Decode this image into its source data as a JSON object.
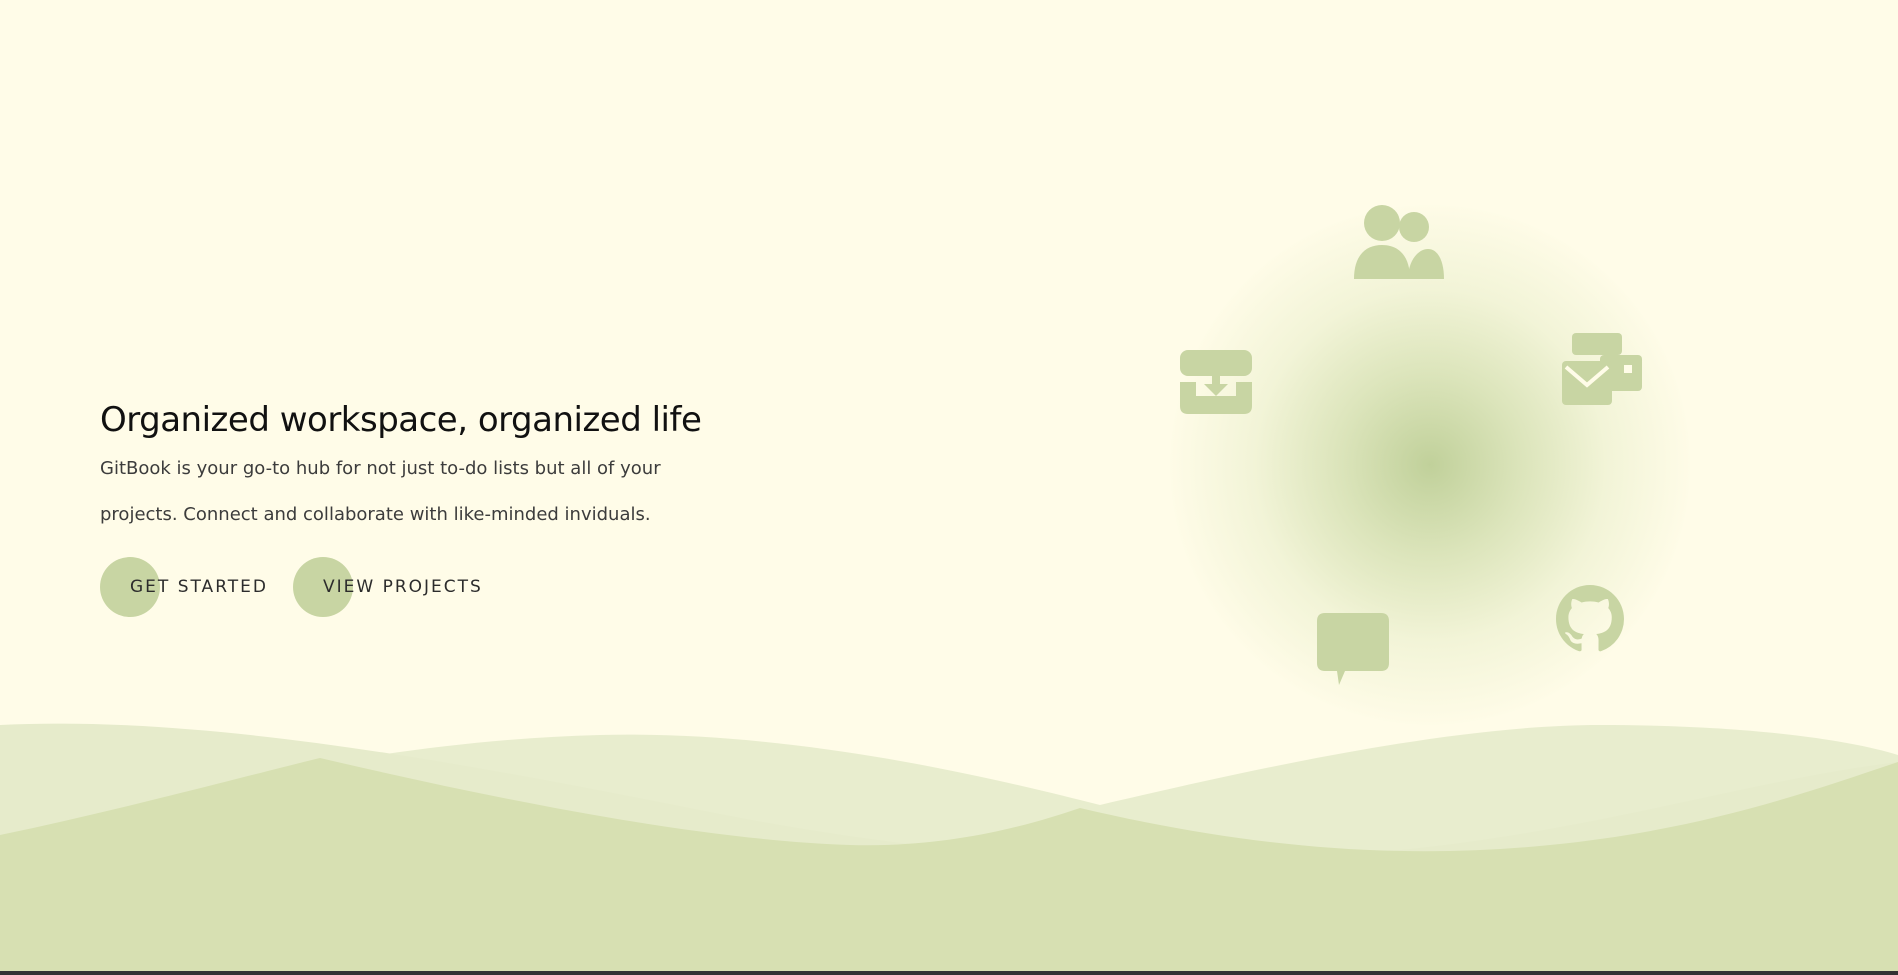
{
  "hero": {
    "headline": "Organized workspace, organized life",
    "description_line1": "GitBook is your go-to hub for not just to-do lists but all of your",
    "description_line2": "projects. Connect and collaborate with like-minded inviduals."
  },
  "buttons": {
    "get_started": "GET STARTED",
    "view_projects": "VIEW PROJECTS"
  },
  "icons": [
    "users-icon",
    "tray-download-icon",
    "mail-card-icon",
    "chat-bubble-icon",
    "github-icon"
  ],
  "colors": {
    "background": "#fffce8",
    "accent": "#c8d5a3",
    "wave_light": "#e6ebcb",
    "wave_dark": "#d7e0b2",
    "text_dark": "#111111"
  }
}
